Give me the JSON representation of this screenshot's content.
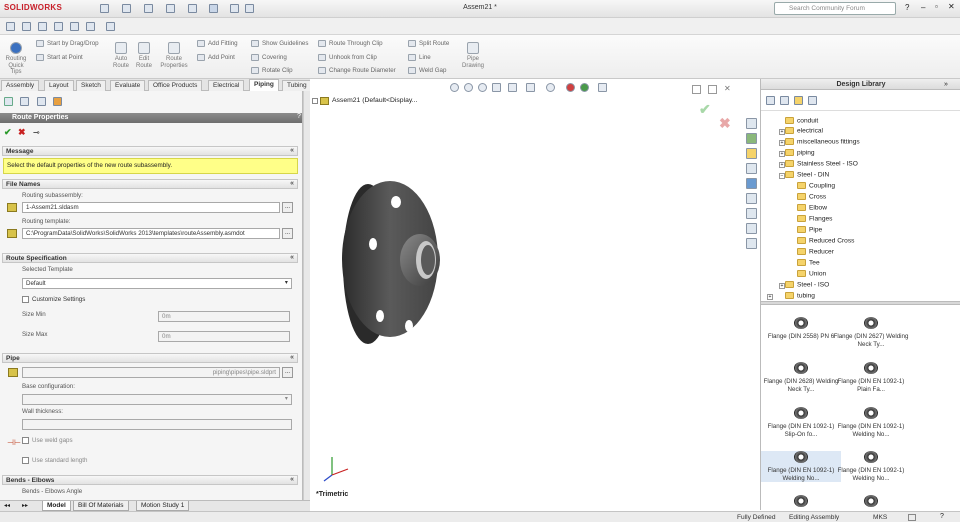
{
  "app": {
    "logo": "SOLIDWORKS",
    "doc_title": "Assem21 *",
    "search_placeholder": "Search Community Forum"
  },
  "command_manager": {
    "routing_quick_tips": "Routing Quick Tips",
    "start_by_drag_drop": "Start by Drag/Drop",
    "start_at_point": "Start at Point",
    "auto_route": "Auto Route",
    "edit_route": "Edit Route",
    "route_properties": "Route Properties",
    "add_fitting": "Add Fitting",
    "add_point": "Add Point",
    "show_guidelines": "Show Guidelines",
    "covering": "Covering",
    "rotate_clip": "Rotate Clip",
    "route_through_clip": "Route Through Clip",
    "unhook_from_clip": "Unhook from Clip",
    "change_route_diameter": "Change Route Diameter",
    "split_route": "Split Route",
    "line": "Line",
    "weld_gap": "Weld Gap",
    "pipe_drawing": "Pipe Drawing"
  },
  "tabs": [
    "Assembly",
    "Layout",
    "Sketch",
    "Evaluate",
    "Office Products",
    "Electrical",
    "Piping",
    "Tubing"
  ],
  "active_tab": "Piping",
  "property_manager": {
    "title": "Route Properties",
    "message_header": "Message",
    "message": "Select the default properties of the new route subassembly.",
    "file_names_header": "File Names",
    "routing_subassembly_label": "Routing subassembly:",
    "routing_subassembly_value": "1-Assem21.sldasm",
    "routing_template_label": "Routing template:",
    "routing_template_value": "C:\\ProgramData\\SolidWorks\\SolidWorks 2013\\templates\\routeAssembly.asmdot",
    "browse": "...",
    "route_spec_header": "Route Specification",
    "selected_template_label": "Selected Template",
    "selected_template_value": "Default",
    "customize_settings": "Customize Settings",
    "size_min_label": "Size Min",
    "size_min_value": "0m",
    "size_max_label": "Size Max",
    "size_max_value": "0m",
    "pipe_header": "Pipe",
    "pipe_value": "piping\\pipes\\pipe.sldprt",
    "base_configuration_label": "Base configuration:",
    "wall_thickness_label": "Wall thickness:",
    "use_weld_gaps": "Use weld gaps",
    "use_standard_length": "Use standard length",
    "bends_header": "Bends - Elbows",
    "bends_angle": "Bends - Elbows Angle"
  },
  "viewport": {
    "tree_item": "Assem21 (Default<Display...",
    "view_label": "*Trimetric"
  },
  "design_library": {
    "title": "Design Library",
    "tree": [
      "conduit",
      "electrical",
      "miscellaneous fittings",
      "piping",
      "Stainless Steel - ISO",
      "Steel - DIN",
      "Coupling",
      "Cross",
      "Elbow",
      "Flanges",
      "Pipe",
      "Reduced Cross",
      "Reducer",
      "Tee",
      "Union",
      "Steel - ISO",
      "tubing"
    ],
    "thumbnails": [
      "Flange (DIN 2558) PN 6",
      "Flange (DIN 2627) Welding Neck Ty...",
      "Flange (DIN 2628) Welding Neck Ty...",
      "Flange (DIN EN 1092-1) Plain Fa...",
      "Flange (DIN EN 1092-1) Slip-On fo...",
      "Flange (DIN EN 1092-1) Welding No...",
      "Flange (DIN EN 1092-1) Welding No...",
      "Flange (DIN EN 1092-1) Welding No..."
    ]
  },
  "bottom_tabs": [
    "Model",
    "Bill Of Materials",
    "Motion Study 1"
  ],
  "status": {
    "state": "Fully Defined",
    "mode": "Editing Assembly",
    "units": "MKS"
  }
}
